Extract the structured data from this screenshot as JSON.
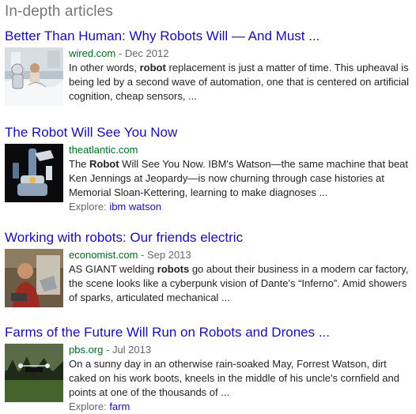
{
  "section_title": "In-depth articles",
  "articles": [
    {
      "title": "Better Than Human: Why Robots Will — And Must ...",
      "source": "wired.com",
      "date_sep": " - ",
      "date": "Dec 2012",
      "snippet_parts": [
        "In other words, ",
        "robot",
        " replacement is just a matter of time. This upheaval is being led by a second wave of automation, one that is centered on artificial cognition, cheap sensors, ..."
      ],
      "thumb_icon": "robot-in-bed-image"
    },
    {
      "title": "The Robot Will See You Now",
      "source": "theatlantic.com",
      "snippet_parts": [
        "The ",
        "Robot",
        " Will See You Now. IBM's Watson—the same machine that beat Ken Jennings at Jeopardy—is now churning through case histories at Memorial Sloan-Kettering, learning to make diagnoses ..."
      ],
      "explore_label": "Explore: ",
      "explore_link": "ibm watson",
      "thumb_icon": "robot-arm-image"
    },
    {
      "title": "Working with robots: Our friends electric",
      "source": "economist.com",
      "date_sep": " - ",
      "date": "Sep 2013",
      "snippet_parts": [
        "AS GIANT welding ",
        "robots",
        " go about their business in a modern car factory, the scene looks like a cyberpunk vision of Dante's “Inferno”. Amid showers of sparks, articulated mechanical ..."
      ],
      "thumb_icon": "man-with-robot-image"
    },
    {
      "title": "Farms of the Future Will Run on Robots and Drones ...",
      "source": "pbs.org",
      "date_sep": " - ",
      "date": "Jul 2013",
      "snippet_parts": [
        "On a sunny day in an otherwise rain-soaked May, Forrest Watson, dirt caked on his work boots, kneels in the middle of his uncle's cornfield and points at one of the thousands of ..."
      ],
      "explore_label": "Explore: ",
      "explore_link": "farm",
      "thumb_icon": "drone-over-field-image"
    }
  ]
}
